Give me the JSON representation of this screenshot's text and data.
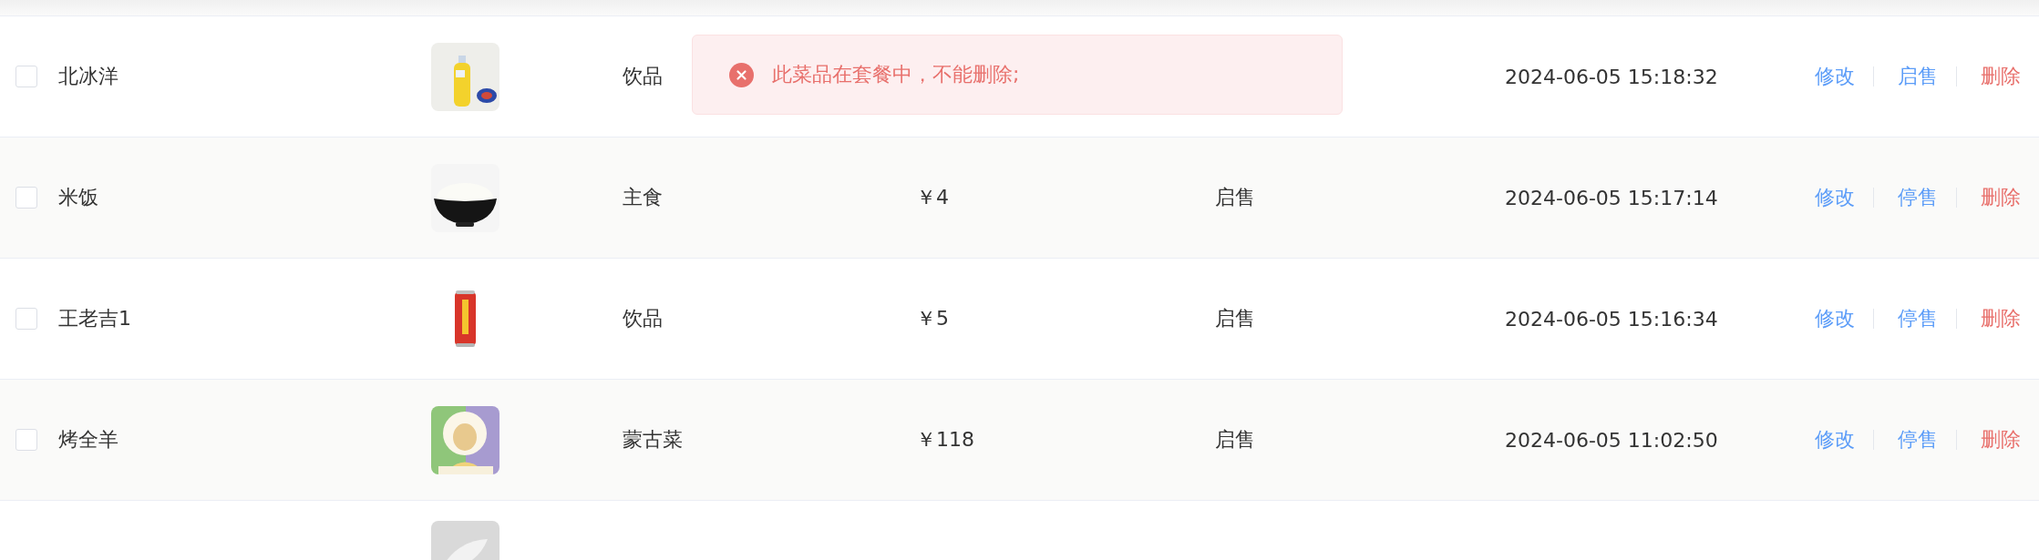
{
  "rows": [
    {
      "checked": false,
      "name": "北冰洋",
      "image": {
        "kind": "picture"
      },
      "category": "饮品",
      "time": "2024-06-05 15:18:32",
      "actions": [
        {
          "label": "修改",
          "kind": "edit"
        },
        {
          "label": "启售",
          "kind": "toggle"
        },
        {
          "label": "删除",
          "kind": "delete"
        }
      ]
    },
    {
      "checked": false,
      "name": "米饭",
      "image": {
        "kind": "picture"
      },
      "category": "主食",
      "price": "￥4",
      "status": "启售",
      "time": "2024-06-05 15:17:14",
      "actions": [
        {
          "label": "修改",
          "kind": "edit"
        },
        {
          "label": "停售",
          "kind": "toggle"
        },
        {
          "label": "删除",
          "kind": "delete"
        }
      ]
    },
    {
      "checked": false,
      "name": "王老吉1",
      "image": {
        "kind": "picture"
      },
      "category": "饮品",
      "price": "￥5",
      "status": "启售",
      "time": "2024-06-05 15:16:34",
      "actions": [
        {
          "label": "修改",
          "kind": "edit"
        },
        {
          "label": "停售",
          "kind": "toggle"
        },
        {
          "label": "删除",
          "kind": "delete"
        }
      ]
    },
    {
      "checked": false,
      "name": "烤全羊",
      "image": {
        "kind": "picture"
      },
      "category": "蒙古菜",
      "price": "￥118",
      "status": "启售",
      "time": "2024-06-05 11:02:50",
      "actions": [
        {
          "label": "修改",
          "kind": "edit"
        },
        {
          "label": "停售",
          "kind": "toggle"
        },
        {
          "label": "删除",
          "kind": "delete"
        }
      ]
    },
    {
      "image": {
        "kind": "picture"
      }
    }
  ],
  "toast": {
    "kind": "error",
    "message": "此菜品在套餐中，不能删除;"
  }
}
